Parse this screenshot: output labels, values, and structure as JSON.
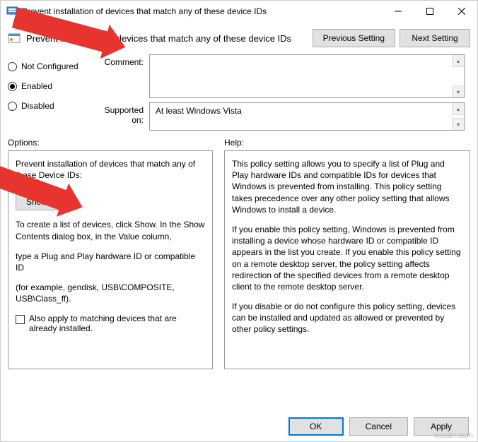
{
  "window": {
    "title": "Prevent installation of devices that match any of these device IDs"
  },
  "header": {
    "policy_title": "Prevent installation of devices that match any of these device IDs",
    "prev_btn": "Previous Setting",
    "next_btn": "Next Setting"
  },
  "state": {
    "not_configured": "Not Configured",
    "enabled": "Enabled",
    "disabled": "Disabled",
    "comment_label": "Comment:",
    "supported_label": "Supported on:",
    "supported_value": "At least Windows Vista"
  },
  "options": {
    "label": "Options:",
    "desc": "Prevent installation of devices that match any of these Device IDs:",
    "show_btn": "Show...",
    "p1": "To create a list of devices, click Show. In the Show Contents dialog box, in the Value column,",
    "p2": "type a Plug and Play hardware ID or compatible ID",
    "p3": "(for example, gendisk, USB\\COMPOSITE, USB\\Class_ff).",
    "chk": "Also apply to matching devices that are already installed."
  },
  "help": {
    "label": "Help:",
    "p1": "This policy setting allows you to specify a list of Plug and Play hardware IDs and compatible IDs for devices that Windows is prevented from installing. This policy setting takes precedence over any other policy setting that allows Windows to install a device.",
    "p2": "If you enable this policy setting, Windows is prevented from installing a device whose hardware ID or compatible ID appears in the list you create. If you enable this policy setting on a remote desktop server, the policy setting affects redirection of the specified devices from a remote desktop client to the remote desktop server.",
    "p3": "If you disable or do not configure this policy setting, devices can be installed and updated as allowed or prevented by other policy settings."
  },
  "footer": {
    "ok": "OK",
    "cancel": "Cancel",
    "apply": "Apply"
  },
  "watermark": "wsxdn.com"
}
